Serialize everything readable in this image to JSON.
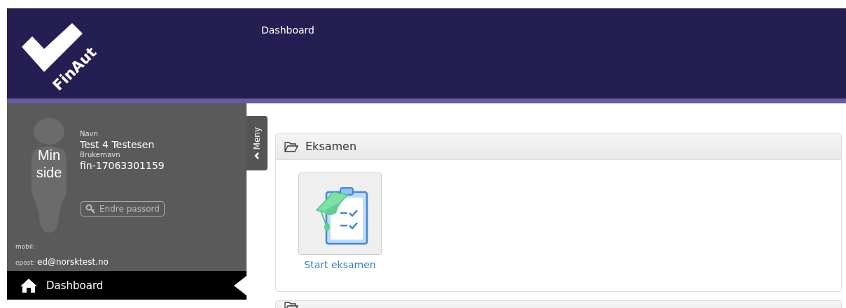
{
  "logo": {
    "text": "FinAut"
  },
  "header": {
    "title": "Dashboard"
  },
  "profile": {
    "avatar_label": "Min side",
    "name_label": "Navn",
    "name": "Test 4 Testesen",
    "username_label": "Brukernavn",
    "username": "fin-17063301159",
    "password_button": "Endre passord",
    "phone_label": "mobil:",
    "email_label": "epost:",
    "email": "ed@norsktest.no"
  },
  "menu_tab": {
    "label": "Meny"
  },
  "nav": [
    {
      "label": "Dashboard",
      "selected": true
    }
  ],
  "panels": [
    {
      "title": "Eksamen",
      "tiles": [
        {
          "label": "Start eksamen"
        }
      ]
    }
  ]
}
